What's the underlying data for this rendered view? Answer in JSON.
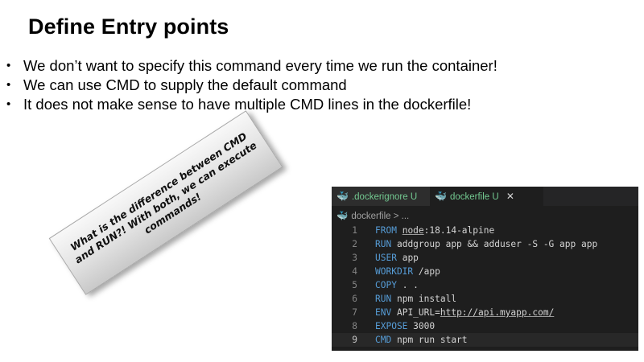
{
  "title": "Define Entry points",
  "bullets": [
    "We don’t want to specify this command every time we run the container!",
    "We can use CMD to supply the default command",
    "It does not make sense to have multiple CMD lines in the dockerfile!"
  ],
  "bullet_symbol": "•",
  "callout": "What is the difference between CMD and RUN?! With both, we can execute commands!",
  "editor": {
    "tabs": [
      {
        "label": ".dockerignore",
        "status": "U",
        "active": false
      },
      {
        "label": "dockerfile",
        "status": "U",
        "active": true,
        "close": "✕"
      }
    ],
    "breadcrumb": {
      "file": "dockerfile",
      "separator": " > ..."
    },
    "lines": [
      {
        "num": "1",
        "kw": "FROM",
        "parts": [
          {
            "t": "node",
            "link": true
          },
          {
            "t": ":18.14-alpine"
          }
        ]
      },
      {
        "num": "2",
        "kw": "RUN",
        "parts": [
          {
            "t": "addgroup app && adduser -S -G app app"
          }
        ]
      },
      {
        "num": "3",
        "kw": "USER",
        "parts": [
          {
            "t": "app"
          }
        ]
      },
      {
        "num": "4",
        "kw": "WORKDIR",
        "parts": [
          {
            "t": "/app"
          }
        ]
      },
      {
        "num": "5",
        "kw": "COPY",
        "parts": [
          {
            "t": ". ."
          }
        ]
      },
      {
        "num": "6",
        "kw": "RUN",
        "parts": [
          {
            "t": "npm install"
          }
        ]
      },
      {
        "num": "7",
        "kw": "ENV",
        "parts": [
          {
            "t": "API_URL="
          },
          {
            "t": "http://api.myapp.com/",
            "link": true
          }
        ]
      },
      {
        "num": "8",
        "kw": "EXPOSE",
        "parts": [
          {
            "t": "3000"
          }
        ]
      },
      {
        "num": "9",
        "kw": "CMD",
        "parts": [
          {
            "t": "npm run start"
          }
        ],
        "current": true
      }
    ],
    "colors": {
      "background": "#1e1e1e",
      "keyword": "#569cd6",
      "text": "#d4d4d4",
      "untracked": "#73c991",
      "docker_icon": "#2496ed"
    },
    "icon": "docker-whale-icon"
  }
}
